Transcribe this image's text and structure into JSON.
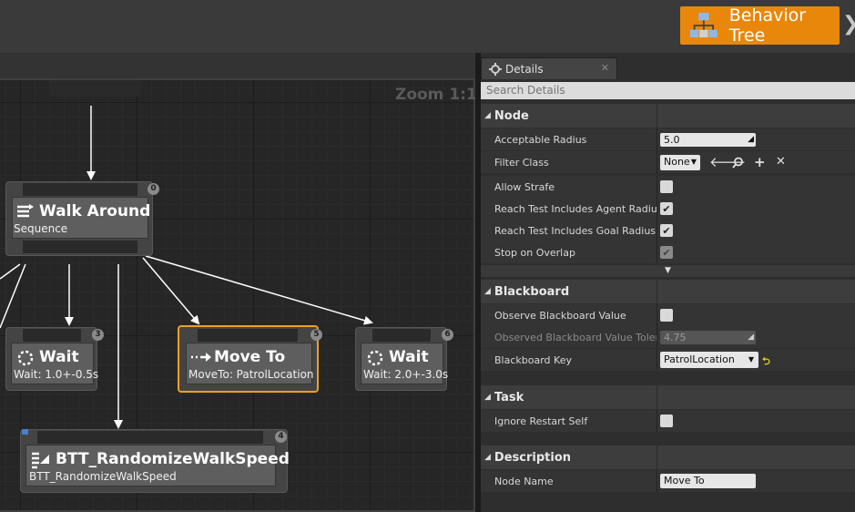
{
  "toolbar": {
    "behavior_tree_label": "Behavior Tree"
  },
  "graph": {
    "zoom_label": "Zoom 1:1"
  },
  "nodes": {
    "walk_around": {
      "title": "Walk Around",
      "subtitle": "Sequence",
      "index": "0"
    },
    "wait_a": {
      "title": "Wait",
      "subtitle": "Wait: 1.0+-0.5s",
      "index": "3"
    },
    "move_to": {
      "title": "Move To",
      "subtitle": "MoveTo: PatrolLocation",
      "index": "5"
    },
    "wait_b": {
      "title": "Wait",
      "subtitle": "Wait: 2.0+-3.0s",
      "index": "6"
    },
    "randomize": {
      "title": "BTT_RandomizeWalkSpeed",
      "subtitle": "BTT_RandomizeWalkSpeed",
      "index": "4"
    }
  },
  "details": {
    "tab_label": "Details",
    "search_placeholder": "Search Details",
    "node_section": {
      "label": "Node",
      "acceptable_radius_label": "Acceptable Radius",
      "acceptable_radius_value": "5.0",
      "filter_class_label": "Filter Class",
      "filter_class_value": "None",
      "allow_strafe_label": "Allow Strafe",
      "allow_strafe": false,
      "reach_agent_label": "Reach Test Includes Agent Radius",
      "reach_agent": true,
      "reach_goal_label": "Reach Test Includes Goal Radius",
      "reach_goal": true,
      "stop_overlap_label": "Stop on Overlap",
      "stop_overlap": true
    },
    "blackboard_section": {
      "label": "Blackboard",
      "observe_value_label": "Observe Blackboard Value",
      "observe_value": false,
      "observed_tolerance_label": "Observed Blackboard Value Toleran",
      "observed_tolerance_value": "4.75",
      "key_label": "Blackboard Key",
      "key_value": "PatrolLocation"
    },
    "task_section": {
      "label": "Task",
      "ignore_restart_label": "Ignore Restart Self",
      "ignore_restart": false
    },
    "description_section": {
      "label": "Description",
      "node_name_label": "Node Name",
      "node_name_value": "Move To"
    }
  },
  "colors": {
    "accent_orange": "#e8870a",
    "node_purple": "#5a2a9a",
    "selection": "#f0a020"
  }
}
